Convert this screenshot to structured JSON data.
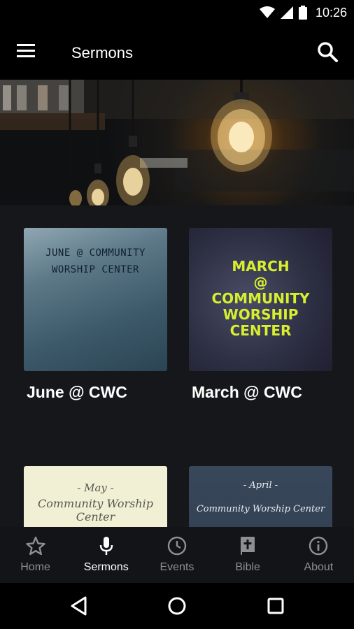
{
  "status_bar": {
    "time": "10:26"
  },
  "app_bar": {
    "title": "Sermons"
  },
  "sermons": [
    {
      "title": "June @ CWC",
      "artwork_lines": [
        "JUNE @ COMMUNITY",
        "WORSHIP CENTER"
      ]
    },
    {
      "title": "March @ CWC",
      "artwork_lines": [
        "MARCH",
        "@",
        "COMMUNITY",
        "WORSHIP",
        "CENTER"
      ]
    },
    {
      "title": "",
      "artwork_lines": [
        "- May -",
        "Community Worship Center"
      ]
    },
    {
      "title": "",
      "artwork_lines": [
        "- April -",
        "Community Worship Center"
      ]
    }
  ],
  "bottom_nav": [
    {
      "label": "Home",
      "icon": "star-icon"
    },
    {
      "label": "Sermons",
      "icon": "microphone-icon",
      "active": true
    },
    {
      "label": "Events",
      "icon": "clock-icon"
    },
    {
      "label": "Bible",
      "icon": "bible-icon"
    },
    {
      "label": "About",
      "icon": "info-icon"
    }
  ],
  "colors": {
    "background": "#16171a",
    "bar": "#000000",
    "accent_text": "#ffffff",
    "inactive_nav": "#8e8f93",
    "march_text": "#d8ef2e"
  }
}
